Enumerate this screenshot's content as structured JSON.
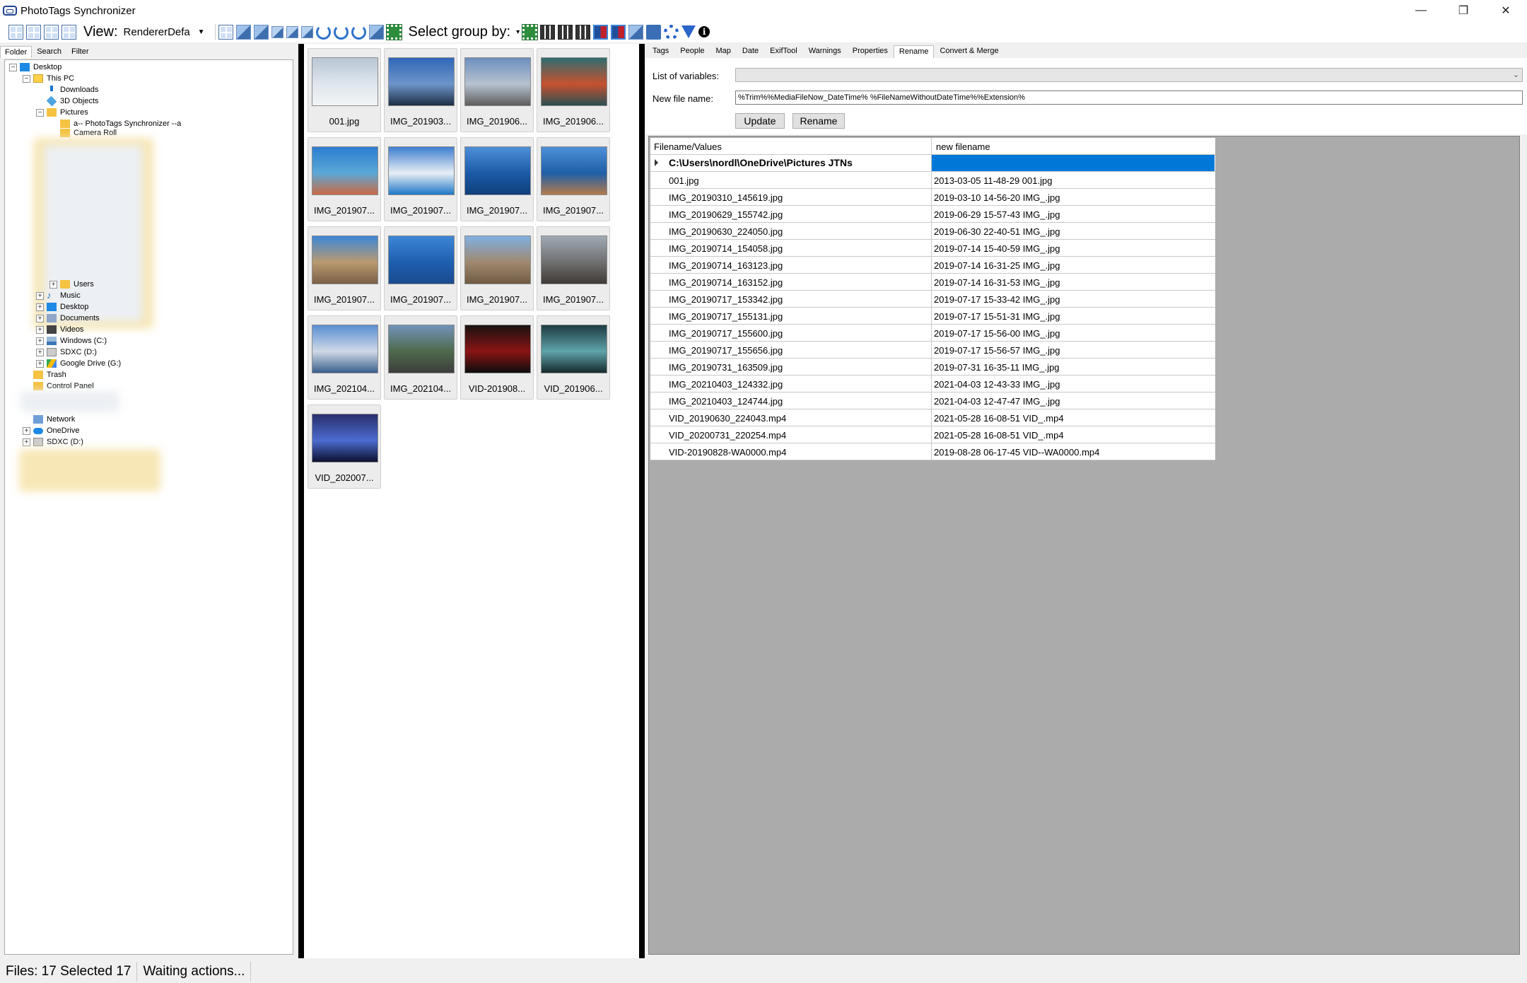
{
  "window": {
    "title": "PhotoTags Synchronizer",
    "controls": [
      "—",
      "❐",
      "✕"
    ]
  },
  "toolbar": {
    "view_label": "View:",
    "renderer_value": "RendererDefa",
    "select_group_label": "Select group by:"
  },
  "left_tabs": [
    "Folder",
    "Search",
    "Filter"
  ],
  "tree": {
    "desktop": "Desktop",
    "this_pc": "This PC",
    "downloads": "Downloads",
    "objects3d": "3D Objects",
    "pictures": "Pictures",
    "phototags": "a-- PhotoTags Synchronizer --a",
    "camera_roll": "Camera Roll",
    "users": "Users",
    "music": "Music",
    "desktop2": "Desktop",
    "documents": "Documents",
    "videos": "Videos",
    "windows_c": "Windows (C:)",
    "sdxc_d": "SDXC (D:)",
    "gdrive": "Google Drive (G:)",
    "trash": "Trash",
    "control_panel": "Control Panel",
    "network": "Network",
    "onedrive": "OneDrive",
    "sdxc_d2": "SDXC (D:)"
  },
  "thumbnails": [
    {
      "caption": "001.jpg",
      "colors": [
        "#b9c6d4",
        "#dfe6ee",
        "#f2f4f6"
      ]
    },
    {
      "caption": "IMG_201903...",
      "colors": [
        "#2f67b8",
        "#6d95c9",
        "#1d2e44"
      ]
    },
    {
      "caption": "IMG_201906...",
      "colors": [
        "#6d8fbf",
        "#b7c2cf",
        "#5d5d5d"
      ]
    },
    {
      "caption": "IMG_201906...",
      "colors": [
        "#2e6d6f",
        "#c7512f",
        "#2a4f53"
      ]
    },
    {
      "caption": "IMG_201907...",
      "colors": [
        "#2c7ed0",
        "#5ba8d6",
        "#c96a45"
      ]
    },
    {
      "caption": "IMG_201907...",
      "colors": [
        "#3f7fcf",
        "#e8eef5",
        "#1f78c7"
      ]
    },
    {
      "caption": "IMG_201907...",
      "colors": [
        "#4e8fd8",
        "#1c5aa8",
        "#103f7a"
      ]
    },
    {
      "caption": "IMG_201907...",
      "colors": [
        "#4d90d8",
        "#1e5fa8",
        "#b47a4c"
      ]
    },
    {
      "caption": "IMG_201907...",
      "colors": [
        "#3d86d6",
        "#b99a6f",
        "#7a6048"
      ]
    },
    {
      "caption": "IMG_201907...",
      "colors": [
        "#3f86d6",
        "#1e5fb0",
        "#1b4b8e"
      ]
    },
    {
      "caption": "IMG_201907...",
      "colors": [
        "#7fb0e2",
        "#a0896e",
        "#6f5a45"
      ]
    },
    {
      "caption": "IMG_201907...",
      "colors": [
        "#9fa9b4",
        "#707070",
        "#3f3a36"
      ]
    },
    {
      "caption": "IMG_202104...",
      "colors": [
        "#5a8fd2",
        "#cfd9e6",
        "#3a5f8c"
      ]
    },
    {
      "caption": "IMG_202104...",
      "colors": [
        "#7393b8",
        "#4e6a4c",
        "#3d3d3d"
      ]
    },
    {
      "caption": "VID-201908...",
      "colors": [
        "#1a1212",
        "#8a1414",
        "#0d0d0d"
      ]
    },
    {
      "caption": "VID_201906...",
      "colors": [
        "#1e3b44",
        "#5ea4a8",
        "#162a2e"
      ]
    },
    {
      "caption": "VID_202007...",
      "colors": [
        "#2a2f6e",
        "#4b6ccf",
        "#0e1030"
      ]
    }
  ],
  "right_tabs": [
    "Tags",
    "People",
    "Map",
    "Date",
    "ExifTool",
    "Warnings",
    "Properties",
    "Rename",
    "Convert & Merge"
  ],
  "rename": {
    "variables_label": "List of variables:",
    "filename_label": "New file name:",
    "filename_value": "%Trim%%MediaFileNow_DateTime% %FileNameWithoutDateTime%%Extension%",
    "update_button": "Update",
    "rename_button": "Rename"
  },
  "grid": {
    "col1_header": "Filename/Values",
    "col2_header": "new filename",
    "group_row": "C:\\Users\\nordl\\OneDrive\\Pictures JTNs",
    "rows": [
      {
        "file": "001.jpg",
        "new": "2013-03-05 11-48-29 001.jpg"
      },
      {
        "file": "IMG_20190310_145619.jpg",
        "new": "2019-03-10 14-56-20 IMG_.jpg"
      },
      {
        "file": "IMG_20190629_155742.jpg",
        "new": "2019-06-29 15-57-43 IMG_.jpg"
      },
      {
        "file": "IMG_20190630_224050.jpg",
        "new": "2019-06-30 22-40-51 IMG_.jpg"
      },
      {
        "file": "IMG_20190714_154058.jpg",
        "new": "2019-07-14 15-40-59 IMG_.jpg"
      },
      {
        "file": "IMG_20190714_163123.jpg",
        "new": "2019-07-14 16-31-25 IMG_.jpg"
      },
      {
        "file": "IMG_20190714_163152.jpg",
        "new": "2019-07-14 16-31-53 IMG_.jpg"
      },
      {
        "file": "IMG_20190717_153342.jpg",
        "new": "2019-07-17 15-33-42 IMG_.jpg"
      },
      {
        "file": "IMG_20190717_155131.jpg",
        "new": "2019-07-17 15-51-31 IMG_.jpg"
      },
      {
        "file": "IMG_20190717_155600.jpg",
        "new": "2019-07-17 15-56-00 IMG_.jpg"
      },
      {
        "file": "IMG_20190717_155656.jpg",
        "new": "2019-07-17 15-56-57 IMG_.jpg"
      },
      {
        "file": "IMG_20190731_163509.jpg",
        "new": "2019-07-31 16-35-11 IMG_.jpg"
      },
      {
        "file": "IMG_20210403_124332.jpg",
        "new": "2021-04-03 12-43-33 IMG_.jpg"
      },
      {
        "file": "IMG_20210403_124744.jpg",
        "new": "2021-04-03 12-47-47 IMG_.jpg"
      },
      {
        "file": "VID_20190630_224043.mp4",
        "new": "2021-05-28 16-08-51 VID_.mp4"
      },
      {
        "file": "VID_20200731_220254.mp4",
        "new": "2021-05-28 16-08-51 VID_.mp4"
      },
      {
        "file": "VID-20190828-WA0000.mp4",
        "new": "2019-08-28 06-17-45 VID--WA0000.mp4"
      }
    ]
  },
  "status": {
    "files": "Files: 17 Selected 17",
    "message": "Waiting actions..."
  },
  "colors": {
    "selection": "#0078d7",
    "grid_background": "#ababab",
    "splitter": "#000000"
  }
}
